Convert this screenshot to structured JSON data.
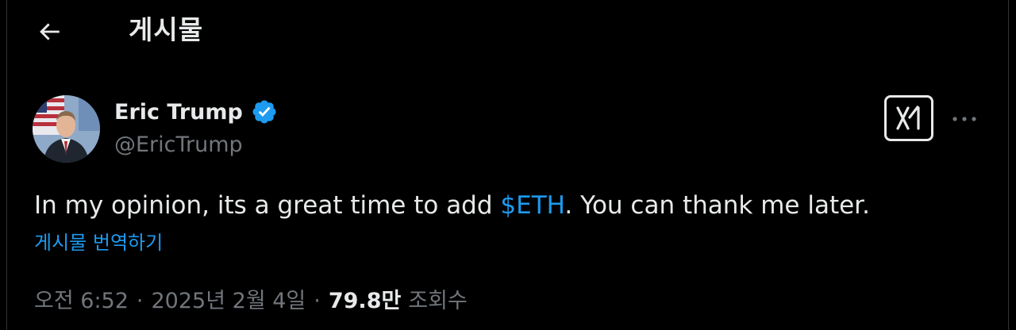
{
  "header": {
    "back_icon": "arrow-left-icon",
    "title": "게시물"
  },
  "author": {
    "name": "Eric Trump",
    "handle": "@EricTrump",
    "verified": true,
    "verified_icon": "verified-badge-icon",
    "avatar_icon": "avatar-photo",
    "accent_color": "#1d9bf0"
  },
  "actions": {
    "grok_icon": "grok-icon",
    "more_icon": "more-dots-icon"
  },
  "post": {
    "text_before": "In my opinion, its a great time to add ",
    "cashtag": "$ETH",
    "text_after": ". You can thank me later.",
    "translate_label": "게시물 번역하기"
  },
  "meta": {
    "time": "오전 6:52",
    "separator": "·",
    "date": "2025년 2월 4일",
    "views_count": "79.8만",
    "views_label": "조회수"
  }
}
